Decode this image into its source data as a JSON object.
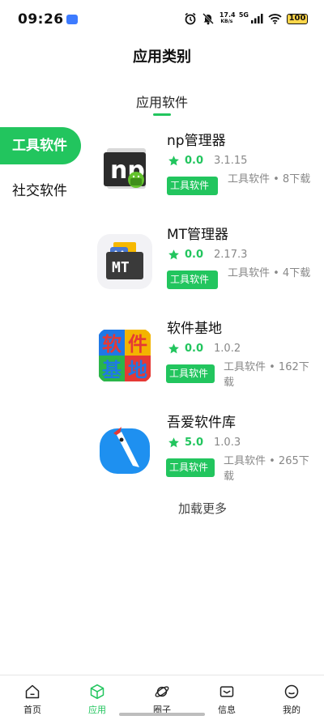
{
  "status_bar": {
    "time": "09:26",
    "net_speed_value": "17.4",
    "net_speed_unit": "KB/s",
    "network_type": "5G",
    "battery": "100"
  },
  "header": {
    "title": "应用类别"
  },
  "top_tabs": [
    {
      "label": "应用软件",
      "active": true
    }
  ],
  "side_categories": [
    {
      "label": "工具软件",
      "active": true
    },
    {
      "label": "社交软件",
      "active": false
    }
  ],
  "apps": [
    {
      "name": "np管理器",
      "rating": "0.0",
      "version": "3.1.15",
      "tag": "工具软件",
      "meta": "工具软件 • 8下载",
      "icon": "np-manager-icon"
    },
    {
      "name": "MT管理器",
      "rating": "0.0",
      "version": "2.17.3",
      "tag": "工具软件",
      "meta": "工具软件 • 4下载",
      "icon": "mt-manager-icon"
    },
    {
      "name": "软件基地",
      "rating": "0.0",
      "version": "1.0.2",
      "tag": "工具软件",
      "meta": "工具软件 • 162下载",
      "icon": "software-base-icon",
      "icon_chars": [
        "软",
        "件",
        "基",
        "地"
      ]
    },
    {
      "name": "吾爱软件库",
      "rating": "5.0",
      "version": "1.0.3",
      "tag": "工具软件",
      "meta": "工具软件 • 265下载",
      "icon": "wuai-library-icon"
    }
  ],
  "load_more": "加载更多",
  "bottom_nav": [
    {
      "label": "首页",
      "icon": "home-icon",
      "active": false
    },
    {
      "label": "应用",
      "icon": "cube-icon",
      "active": true
    },
    {
      "label": "圈子",
      "icon": "planet-icon",
      "active": false
    },
    {
      "label": "信息",
      "icon": "mail-icon",
      "active": false
    },
    {
      "label": "我的",
      "icon": "smile-icon",
      "active": false
    }
  ],
  "colors": {
    "accent": "#22c55e",
    "text": "#111111",
    "muted": "#888888"
  }
}
